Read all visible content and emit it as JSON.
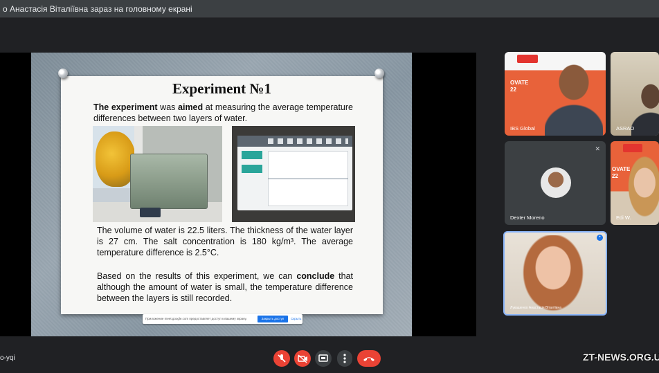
{
  "topbar": {
    "presenting_text": "о Анастасія Віталіївна зараз на головному екрані"
  },
  "slide": {
    "title": "Experiment №1",
    "intro_bold_1": "The experiment",
    "intro_mid": " was ",
    "intro_bold_2": "aimed",
    "intro_rest": " at measuring the average temperature differences between two layers of water.",
    "details": "The volume of water is 22.5 liters. The thickness of the water layer is 27 cm. The salt concentration is 180 kg/m³. The average temperature difference is 2.5°C.",
    "conclusion_pre": "Based on the results of this experiment, we can ",
    "conclusion_bold": "conclude",
    "conclusion_post": " that although the amount of water is small, the temperature difference between the layers is still recorded."
  },
  "share_notice": {
    "text": "Приложение meet.google.com предоставляет доступ к вашему экрану.",
    "stop_button": "Закрыть доступ",
    "hide_button": "Скрыть"
  },
  "participants": [
    {
      "name": "IBS Global",
      "overlay": "OVATE\n22"
    },
    {
      "name": "ASRAO"
    },
    {
      "name": "Dexter Moreno"
    },
    {
      "name": "Edi W.",
      "overlay": "OVATE\n22"
    },
    {
      "name": "Лукашенко Анастасія Віталіївна"
    }
  ],
  "meeting_code": "o-yqi",
  "controls": {
    "mic_icon": "mic-off-icon",
    "cam_icon": "camera-off-icon",
    "present_icon": "present-screen-icon",
    "more_icon": "more-vert-icon",
    "end_icon": "end-call-icon"
  },
  "watermark": "ZT-NEWS.ORG.UA",
  "colors": {
    "danger": "#ea4335",
    "accent": "#1a73e8",
    "background": "#202124"
  }
}
